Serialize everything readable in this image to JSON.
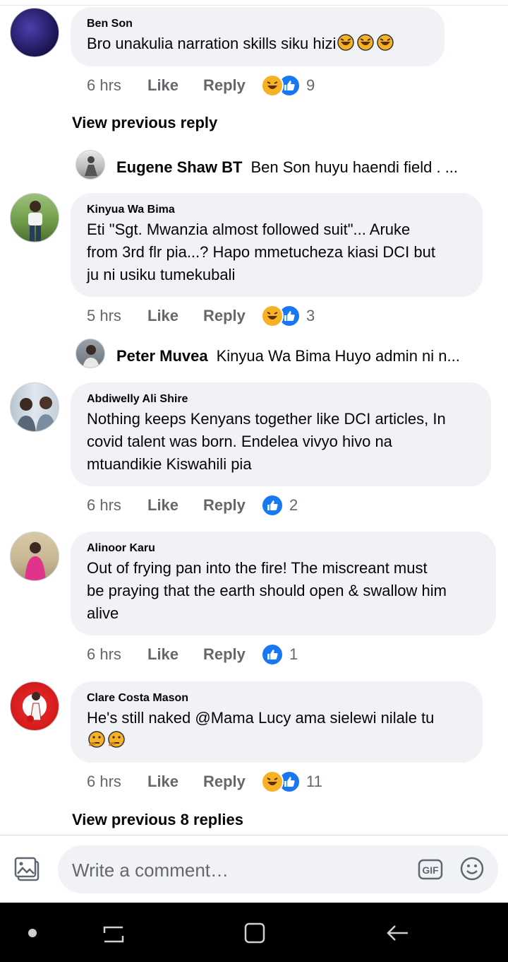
{
  "comments": [
    {
      "author": "Ben Son",
      "text": "Bro unakulia narration skills siku hizi",
      "time": "6 hrs",
      "like": "Like",
      "reply": "Reply",
      "reactions": [
        "haha",
        "like"
      ],
      "count": "9"
    },
    {
      "author": "Kinyua Wa Bima",
      "text": "Eti \"Sgt. Mwanzia almost followed suit\"... Aruke\nfrom 3rd flr pia...? Hapo mmetucheza kiasi DCI but\nju ni usiku tumekubali",
      "time": "5 hrs",
      "like": "Like",
      "reply": "Reply",
      "reactions": [
        "haha",
        "like"
      ],
      "count": "3"
    },
    {
      "author": "Abdiwelly Ali Shire",
      "text": "Nothing keeps Kenyans together like DCI articles, In\ncovid talent was born. Endelea vivyo hivo na\nmtuandikie Kiswahili pia",
      "time": "6 hrs",
      "like": "Like",
      "reply": "Reply",
      "reactions": [
        "like"
      ],
      "count": "2"
    },
    {
      "author": "Alinoor Karu",
      "text": "Out of frying pan into the fire! The miscreant must\nbe praying that the earth should open & swallow him\nalive",
      "time": "6 hrs",
      "like": "Like",
      "reply": "Reply",
      "reactions": [
        "like"
      ],
      "count": "1"
    },
    {
      "author": "Clare Costa Mason",
      "text": "He's still naked @Mama Lucy ama sielewi nilale tu",
      "time": "6 hrs",
      "like": "Like",
      "reply": "Reply",
      "reactions": [
        "haha",
        "like"
      ],
      "count": "11"
    }
  ],
  "view_previous_reply": "View previous reply",
  "view_previous_8_replies": "View previous 8 replies",
  "replies": [
    {
      "author": "Eugene Shaw BT",
      "preview": "Ben Son  huyu haendi field . ..."
    },
    {
      "author": "Peter Muvea",
      "preview": "Kinyua Wa Bima Huyo admin ni n..."
    }
  ],
  "composer": {
    "placeholder": "Write a comment…",
    "gif_label": "GIF"
  },
  "colors": {
    "bubble": "#f0f2f5",
    "like_blue": "#1877f2",
    "haha_yellow": "#f7b125",
    "meta_gray": "#65676b"
  }
}
